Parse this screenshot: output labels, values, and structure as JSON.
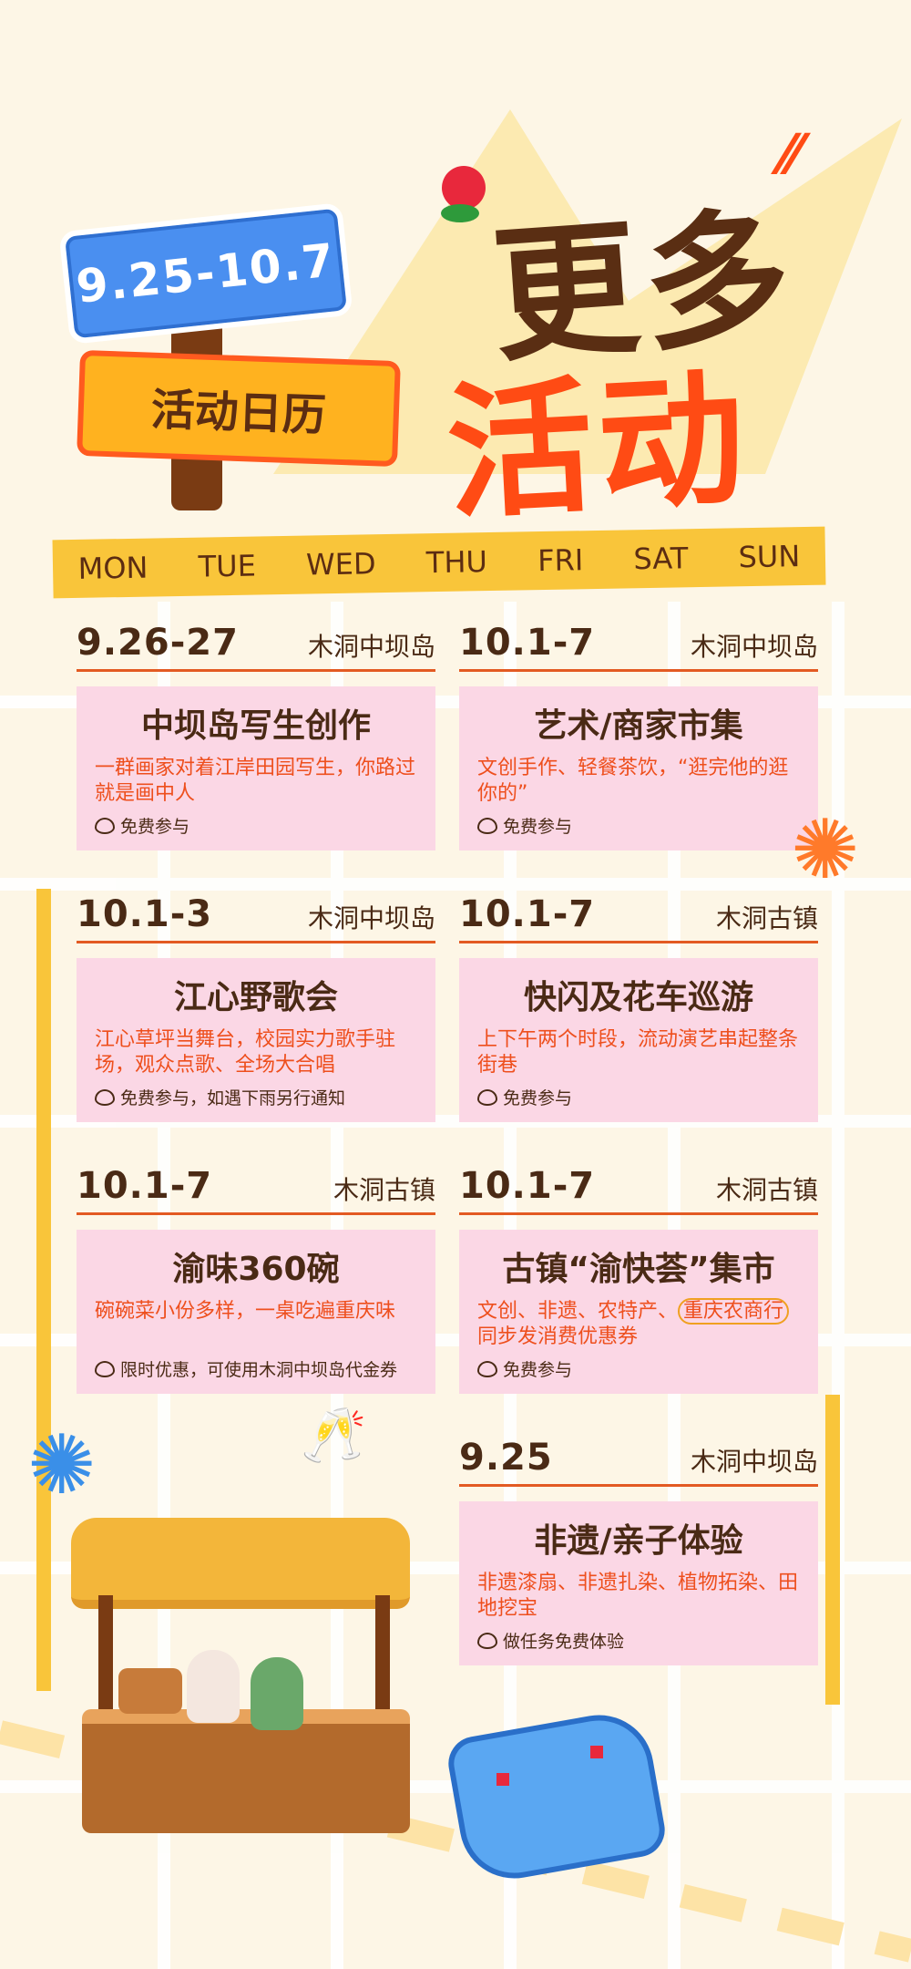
{
  "header": {
    "date_range": "9.25-10.7",
    "calendar_label": "活动日历",
    "title_line1": "更多",
    "title_line2": "活动"
  },
  "days": [
    "MON",
    "TUE",
    "WED",
    "THU",
    "FRI",
    "SAT",
    "SUN"
  ],
  "events": [
    {
      "date": "9.26-27",
      "location": "木洞中坝岛",
      "title": "中坝岛写生创作",
      "desc": "一群画家对着江岸田园写生，你路过就是画中人",
      "note": "免费参与"
    },
    {
      "date": "10.1-7",
      "location": "木洞中坝岛",
      "title": "艺术/商家市集",
      "desc": "文创手作、轻餐茶饮，“逛完他的逛你的”",
      "note": "免费参与"
    },
    {
      "date": "10.1-3",
      "location": "木洞中坝岛",
      "title": "江心野歌会",
      "desc": "江心草坪当舞台，校园实力歌手驻场，观众点歌、全场大合唱",
      "note": "免费参与，如遇下雨另行通知"
    },
    {
      "date": "10.1-7",
      "location": "木洞古镇",
      "title": "快闪及花车巡游",
      "desc": "上下午两个时段，流动演艺串起整条街巷",
      "note": "免费参与"
    },
    {
      "date": "10.1-7",
      "location": "木洞古镇",
      "title": "渝味360碗",
      "desc": "碗碗菜小份多样，一桌吃遍重庆味",
      "note": "限时优惠，可使用木洞中坝岛代金券"
    },
    {
      "date": "10.1-7",
      "location": "木洞古镇",
      "title": "古镇“渝快荟”集市",
      "desc_a": "文创、非遗、农特产、",
      "desc_highlight": "重庆农商行",
      "desc_b": "同步发消费优惠券",
      "note": "免费参与"
    },
    {
      "date": "9.25",
      "location": "木洞中坝岛",
      "title": "非遗/亲子体验",
      "desc": "非遗漆扇、非遗扎染、植物拓染、田地挖宝",
      "note": "做任务免费体验"
    }
  ],
  "colors": {
    "background": "#fdf6e6",
    "card_pink": "#fbd7e5",
    "accent_orange": "#ee4f1d",
    "text_brown": "#4a2a15",
    "yellow": "#f9c53a",
    "blue_sign": "#4a8ff0"
  },
  "icons": [
    "ticket-icon",
    "flower-icon",
    "firework-icon",
    "map-icon",
    "booth-illustration",
    "toast-glasses-icon"
  ]
}
